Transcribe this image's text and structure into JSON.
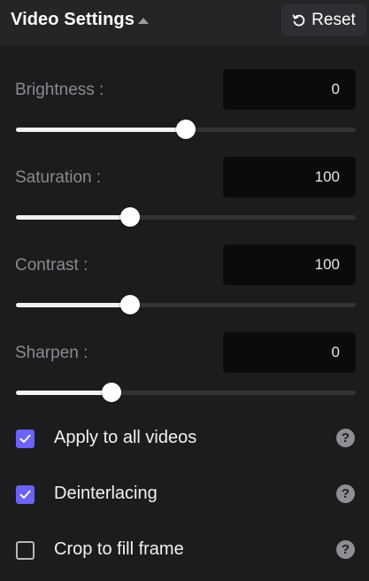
{
  "header": {
    "title": "Video Settings",
    "collapse_icon": "caret-up-icon",
    "reset_label": "Reset",
    "reset_icon": "reset-icon"
  },
  "settings": [
    {
      "id": "brightness",
      "label": "Brightness :",
      "value": "0",
      "slider_level": 0.5
    },
    {
      "id": "saturation",
      "label": "Saturation :",
      "value": "100",
      "slider_level": 0.335
    },
    {
      "id": "contrast",
      "label": "Contrast :",
      "value": "100",
      "slider_level": 0.335
    },
    {
      "id": "sharpen",
      "label": "Sharpen :",
      "value": "0",
      "slider_level": 0.28
    }
  ],
  "options": [
    {
      "id": "apply-all",
      "label": "Apply to all videos",
      "checked": true
    },
    {
      "id": "deinterlacing",
      "label": "Deinterlacing",
      "checked": true
    },
    {
      "id": "crop-fill",
      "label": "Crop to fill frame",
      "checked": false
    }
  ],
  "help_glyph": "?",
  "colors": {
    "accent": "#6b63f5",
    "background": "#1c1c1e",
    "header": "#252527",
    "value_box": "#0b0b0c"
  }
}
